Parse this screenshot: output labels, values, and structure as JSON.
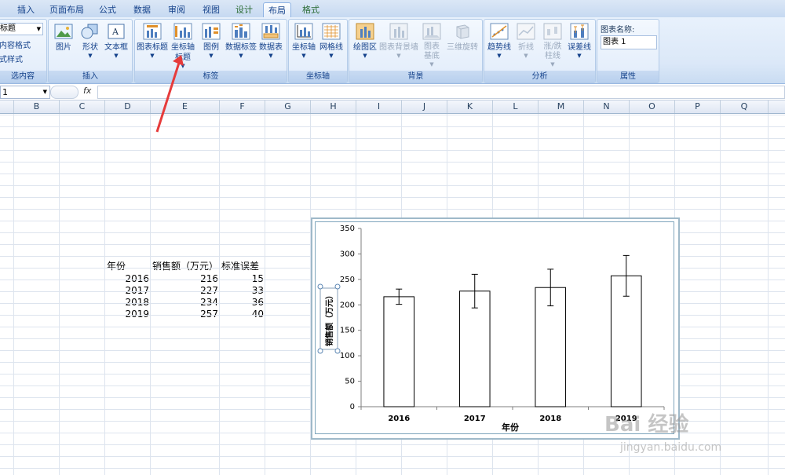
{
  "tabs": [
    "插入",
    "页面布局",
    "公式",
    "数据",
    "审阅",
    "视图",
    "设计",
    "布局",
    "格式"
  ],
  "active_tab": "布局",
  "ribbon": {
    "current_selection": {
      "dropdown": "标题",
      "items": [
        "内容格式",
        "式样式"
      ],
      "label": "选内容"
    },
    "insert": {
      "label": "插入",
      "buttons": [
        "图片",
        "形状",
        "文本框"
      ]
    },
    "labels": {
      "label": "标签",
      "buttons": [
        "图表标题",
        "坐标轴标题",
        "图例",
        "数据标签",
        "数据表"
      ]
    },
    "axes": {
      "label": "坐标轴",
      "buttons": [
        "坐标轴",
        "网格线"
      ]
    },
    "background": {
      "label": "背景",
      "buttons": [
        "绘图区",
        "图表背景墙",
        "图表基底",
        "三维旋转"
      ]
    },
    "analysis": {
      "label": "分析",
      "buttons": [
        "趋势线",
        "折线",
        "涨/跌柱线",
        "误差线"
      ]
    },
    "properties": {
      "label": "属性",
      "chart_name_label": "图表名称:",
      "chart_name_value": "图表 1"
    }
  },
  "formula_bar": {
    "name_box": "1",
    "fx": "fx",
    "value": ""
  },
  "columns": [
    "B",
    "C",
    "D",
    "E",
    "F",
    "G",
    "H",
    "I",
    "J",
    "K",
    "L",
    "M",
    "N",
    "O",
    "P",
    "Q"
  ],
  "table": {
    "headers": [
      "年份",
      "销售额（万元）",
      "标准误差"
    ],
    "rows": [
      [
        "2016",
        "216",
        "15"
      ],
      [
        "2017",
        "227",
        "33"
      ],
      [
        "2018",
        "234",
        "36"
      ],
      [
        "2019",
        "257",
        "40"
      ]
    ]
  },
  "watermark": "jingyan.baidu.com",
  "watermark_brand": "Bai 经验",
  "chart_data": {
    "type": "bar",
    "categories": [
      "2016",
      "2017",
      "2018",
      "2019"
    ],
    "values": [
      216,
      227,
      234,
      257
    ],
    "error": [
      15,
      33,
      36,
      40
    ],
    "xlabel": "年份",
    "ylabel": "销售额（万元）",
    "ylim": [
      0,
      350
    ],
    "yticks": [
      0,
      50,
      100,
      150,
      200,
      250,
      300,
      350
    ],
    "grid": false
  }
}
